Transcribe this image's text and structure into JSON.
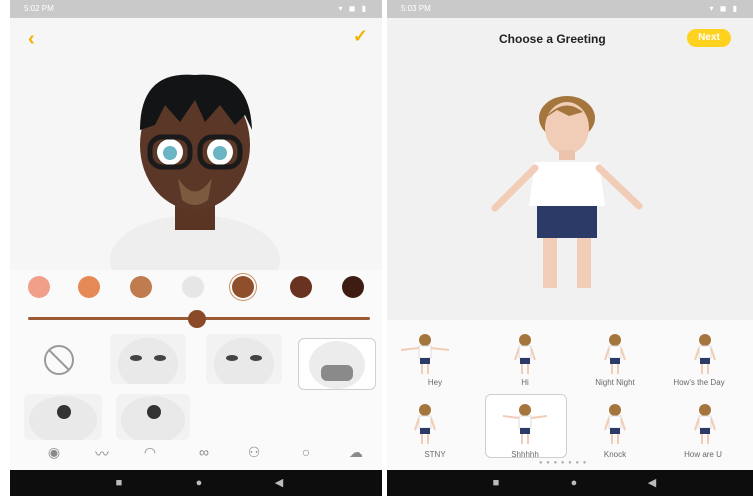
{
  "left_screen": {
    "status_time": "5:02 PM",
    "status_icons": "▾ ◼ ▮",
    "back_icon": "chevron-left",
    "confirm_icon": "checkmark",
    "colors": {
      "accent": "#f0b400",
      "swatches": [
        "#f0a089",
        "#e58a57",
        "#c07c4e",
        "#e6e6e6",
        "#8f4f2a",
        "#6a3220",
        "#3f1c12"
      ],
      "selected_swatch_index": 4
    },
    "skin_slider_value": 0.5,
    "category_icons": [
      "face-icon",
      "mustache-icon",
      "lips-icon",
      "glasses-icon",
      "accessory-icon",
      "head-shape-icon",
      "hair-icon"
    ]
  },
  "right_screen": {
    "status_time": "5:03 PM",
    "status_icons": "▾ ◼ ▮",
    "title": "Choose a Greeting",
    "next_button": "Next",
    "greetings_row1": [
      "Hey",
      "Hi",
      "Night Night",
      "How's the Day"
    ],
    "greetings_row2": [
      "STNY",
      "Shhhhh",
      "Knock",
      "How are U"
    ],
    "selected_greeting_index": 5,
    "page_dots": "● ● ● ● ● ● ●"
  },
  "nav": {
    "recent": "■",
    "home": "●",
    "back": "◀"
  }
}
